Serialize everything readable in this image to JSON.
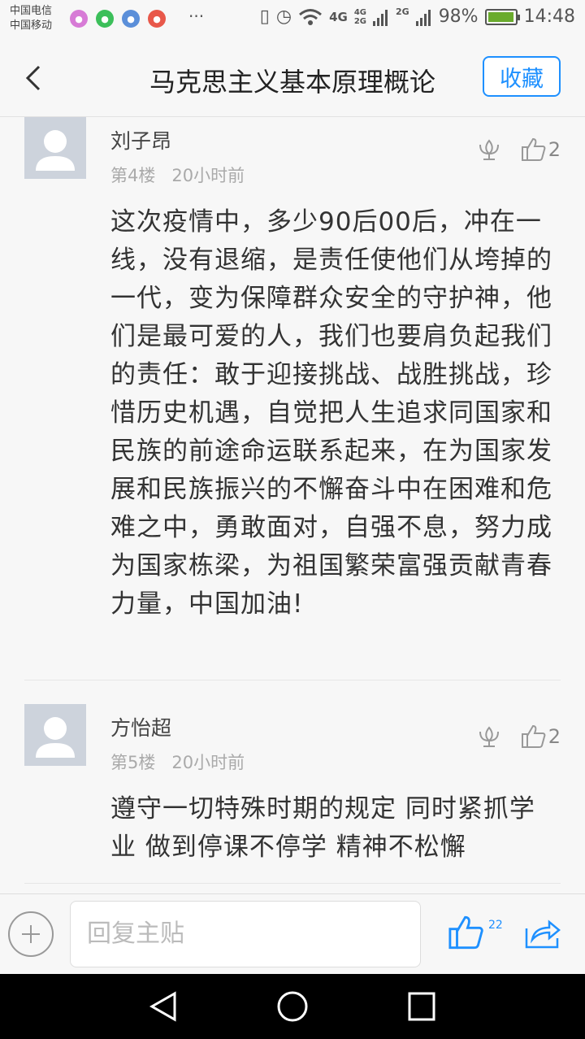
{
  "status_bar": {
    "carrier_1": "中国电信",
    "carrier_2": "中国移动",
    "more": "···",
    "network_4g": "4G",
    "network_4g2g_top": "4G",
    "network_4g2g_bottom": "2G",
    "network_2g": "2G",
    "battery_text": "98%",
    "battery_level": 0.98,
    "time": "14:48"
  },
  "navbar": {
    "title": "马克思主义基本原理概论",
    "favorite_label": "收藏"
  },
  "posts": [
    {
      "author": "刘子昂",
      "floor": "第4楼",
      "time": "20小时前",
      "likes": "2",
      "content": "这次疫情中，多少90后00后，冲在一线，没有退缩，是责任使他们从垮掉的一代，变为保障群众安全的守护神，他们是最可爱的人，我们也要肩负起我们的责任：敢于迎接挑战、战胜挑战，珍惜历史机遇，自觉把人生追求同国家和民族的前途命运联系起来，在为国家发展和民族振兴的不懈奋斗中在困难和危难之中，勇敢面对，自强不息，努力成为国家栋梁，为祖国繁荣富强贡献青春力量，中国加油!"
    },
    {
      "author": "方怡超",
      "floor": "第5楼",
      "time": "20小时前",
      "likes": "2",
      "content": "遵守一切特殊时期的规定 同时紧抓学业 做到停课不停学 精神不松懈"
    }
  ],
  "reply_bar": {
    "placeholder": "回复主贴",
    "like_count": "22"
  },
  "colors": {
    "accent": "#1e90ff",
    "battery": "#6aab2d",
    "background": "#f7f7f7"
  },
  "icons": [
    "back-arrow-icon",
    "flower-icon",
    "thumbs-up-icon",
    "plus-icon",
    "share-icon",
    "nav-back-icon",
    "nav-home-icon",
    "nav-recents-icon"
  ]
}
